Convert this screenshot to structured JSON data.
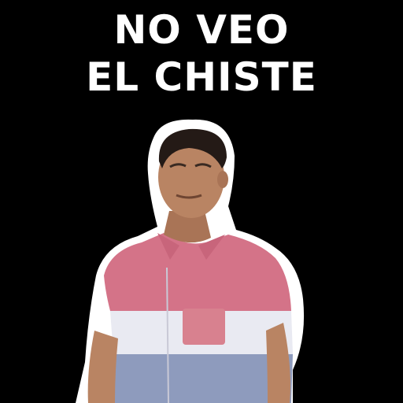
{
  "caption": {
    "line1": "NO VEO",
    "line2": "EL CHISTE"
  },
  "figure": {
    "icon": "person-photo-icon",
    "description_colors": {
      "background": "#000000",
      "outline": "#ffffff",
      "skin": "#b98463",
      "hair": "#241a16",
      "shirt_pink": "#d47388",
      "shirt_white": "#e9eaf2",
      "shirt_blue": "#8e9bbd"
    }
  }
}
